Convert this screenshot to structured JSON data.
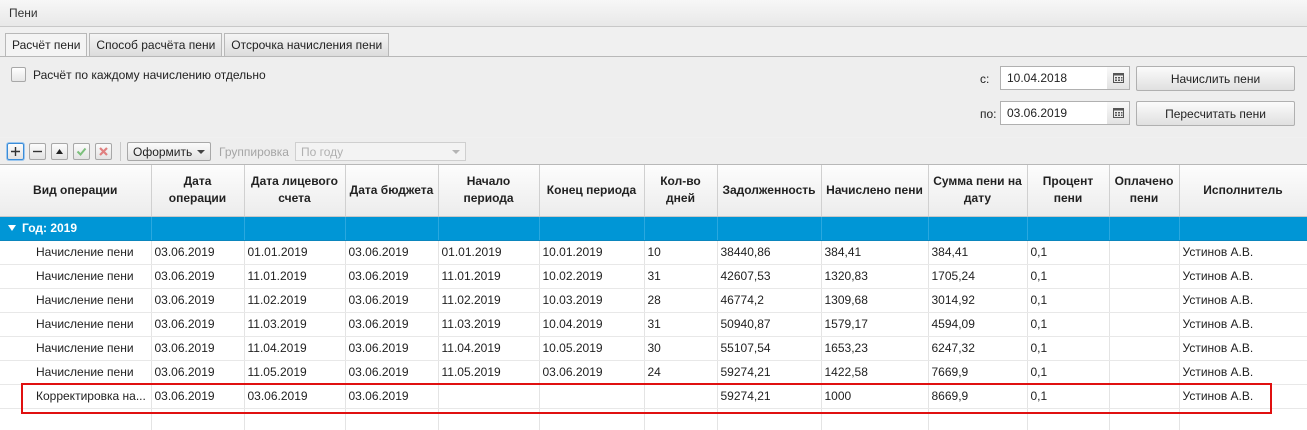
{
  "window": {
    "title": "Пени"
  },
  "tabs": [
    {
      "label": "Расчёт пени",
      "active": true
    },
    {
      "label": "Способ расчёта пени",
      "active": false
    },
    {
      "label": "Отсрочка начисления пени",
      "active": false
    }
  ],
  "options": {
    "each_accrual_label": "Расчёт по каждому начислению отдельно",
    "each_accrual_checked": false
  },
  "period": {
    "from_label": "с:",
    "from_value": "10.04.2018",
    "to_label": "по:",
    "to_value": "03.06.2019"
  },
  "actions": {
    "calculate": "Начислить пени",
    "recalculate": "Пересчитать пени"
  },
  "toolbar": {
    "add_icon": "plus-icon",
    "remove_icon": "minus-icon",
    "up_icon": "arrow-up-icon",
    "confirm_icon": "check-icon",
    "delete_icon": "cross-icon",
    "format_label": "Оформить",
    "grouping_label": "Группировка",
    "grouping_value": "По году"
  },
  "table": {
    "columns": [
      "Вид операции",
      "Дата операции",
      "Дата лицевого счета",
      "Дата бюджета",
      "Начало периода",
      "Конец периода",
      "Кол-во дней",
      "Задолженность",
      "Начислено пени",
      "Сумма пени на дату",
      "Процент пени",
      "Оплачено пени",
      "Исполнитель"
    ],
    "group_label": "Год: 2019",
    "rows": [
      [
        "Начисление пени",
        "03.06.2019",
        "01.01.2019",
        "03.06.2019",
        "01.01.2019",
        "10.01.2019",
        "10",
        "38440,86",
        "384,41",
        "384,41",
        "0,1",
        "",
        "Устинов А.В."
      ],
      [
        "Начисление пени",
        "03.06.2019",
        "11.01.2019",
        "03.06.2019",
        "11.01.2019",
        "10.02.2019",
        "31",
        "42607,53",
        "1320,83",
        "1705,24",
        "0,1",
        "",
        "Устинов А.В."
      ],
      [
        "Начисление пени",
        "03.06.2019",
        "11.02.2019",
        "03.06.2019",
        "11.02.2019",
        "10.03.2019",
        "28",
        "46774,2",
        "1309,68",
        "3014,92",
        "0,1",
        "",
        "Устинов А.В."
      ],
      [
        "Начисление пени",
        "03.06.2019",
        "11.03.2019",
        "03.06.2019",
        "11.03.2019",
        "10.04.2019",
        "31",
        "50940,87",
        "1579,17",
        "4594,09",
        "0,1",
        "",
        "Устинов А.В."
      ],
      [
        "Начисление пени",
        "03.06.2019",
        "11.04.2019",
        "03.06.2019",
        "11.04.2019",
        "10.05.2019",
        "30",
        "55107,54",
        "1653,23",
        "6247,32",
        "0,1",
        "",
        "Устинов А.В."
      ],
      [
        "Начисление пени",
        "03.06.2019",
        "11.05.2019",
        "03.06.2019",
        "11.05.2019",
        "03.06.2019",
        "24",
        "59274,21",
        "1422,58",
        "7669,9",
        "0,1",
        "",
        "Устинов А.В."
      ],
      [
        "Корректировка на...",
        "03.06.2019",
        "03.06.2019",
        "03.06.2019",
        "",
        "",
        "",
        "59274,21",
        "1000",
        "8669,9",
        "0,1",
        "",
        "Устинов А.В."
      ]
    ]
  },
  "colors": {
    "group_row": "#0096d6",
    "highlight": "#e01010"
  }
}
